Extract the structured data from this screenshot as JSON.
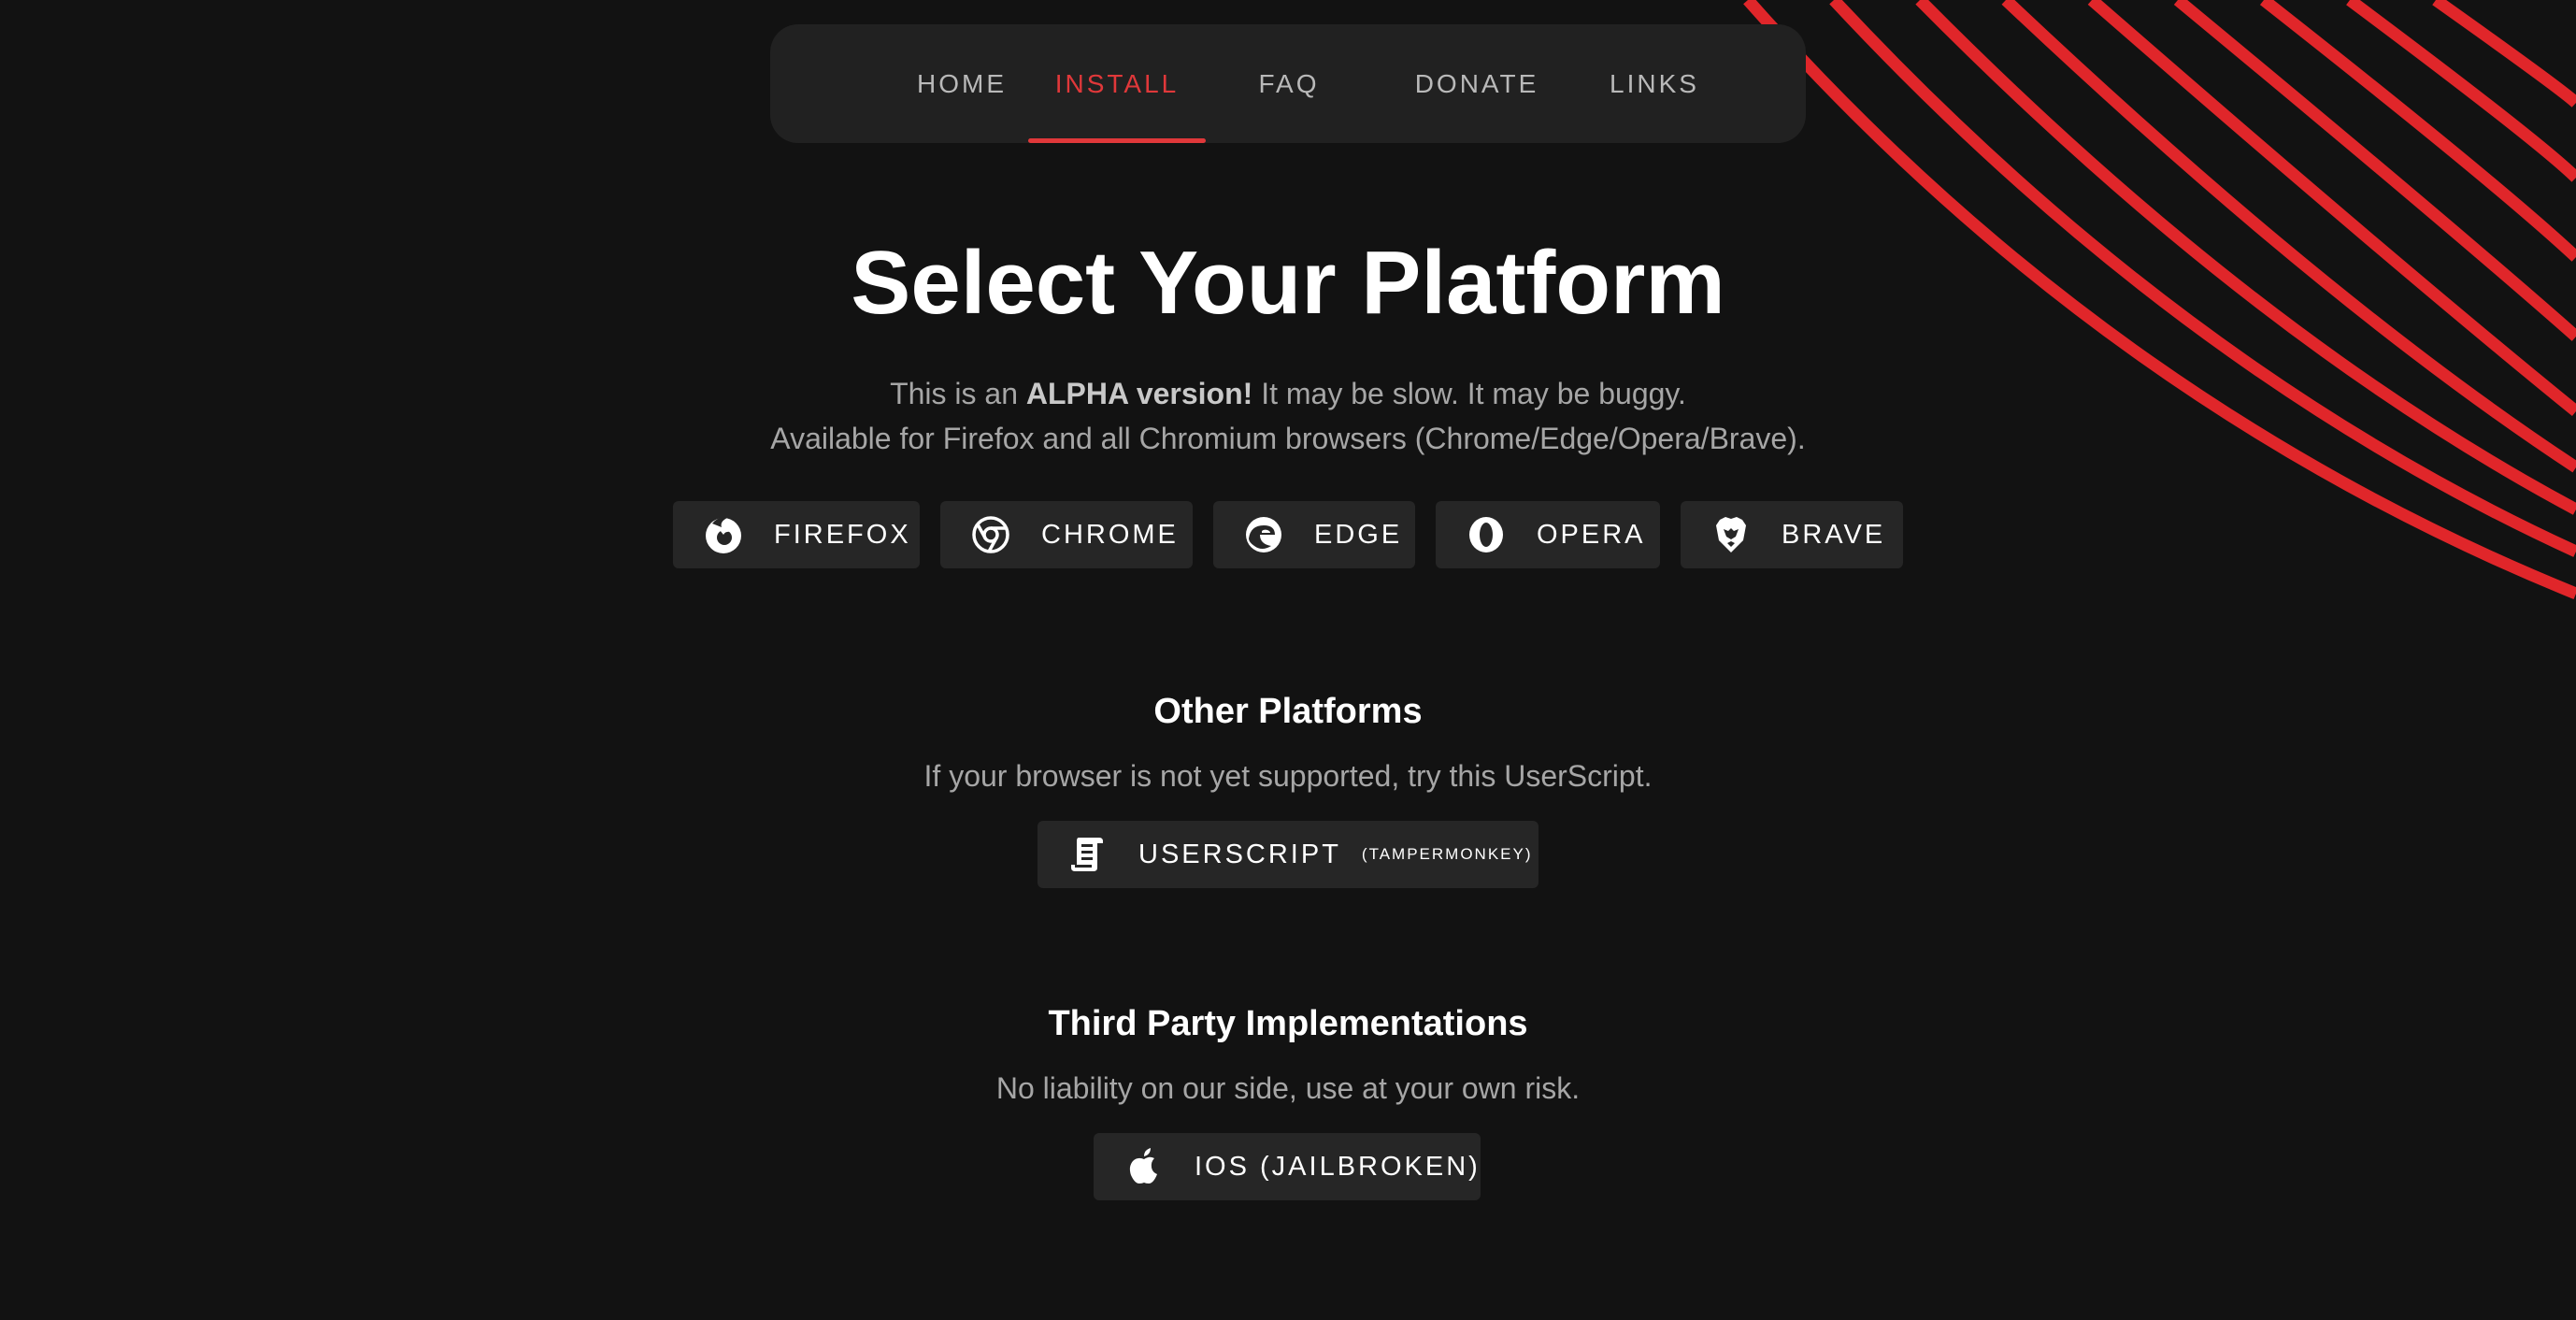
{
  "nav": {
    "items": [
      {
        "label": "HOME"
      },
      {
        "label": "INSTALL",
        "active": true
      },
      {
        "label": "FAQ"
      },
      {
        "label": "DONATE"
      },
      {
        "label": "LINKS"
      }
    ]
  },
  "main": {
    "title": "Select Your Platform",
    "alpha_prefix": "This is an",
    "alpha_bold": "ALPHA version!",
    "alpha_suffix": "It may be slow. It may be buggy.",
    "availability": "Available for Firefox and all Chromium browsers (Chrome/Edge/Opera/Brave).",
    "browsers": [
      {
        "label": "FIREFOX",
        "icon": "firefox-icon"
      },
      {
        "label": "CHROME",
        "icon": "chrome-icon"
      },
      {
        "label": "EDGE",
        "icon": "edge-icon"
      },
      {
        "label": "OPERA",
        "icon": "opera-icon"
      },
      {
        "label": "BRAVE",
        "icon": "brave-icon"
      }
    ]
  },
  "other": {
    "title": "Other Platforms",
    "text": "If your browser is not yet supported, try this UserScript.",
    "button_label": "USERSCRIPT",
    "button_sublabel": "(TAMPERMONKEY)",
    "icon": "script-scroll-icon"
  },
  "third_party": {
    "title": "Third Party Implementations",
    "text": "No liability on our side, use at your own risk.",
    "button_label": "IOS (JAILBROKEN)",
    "icon": "apple-icon"
  },
  "colors": {
    "background": "#121212",
    "accent": "#e0383a",
    "button_bg": "#262626",
    "nav_bg": "#212121"
  }
}
